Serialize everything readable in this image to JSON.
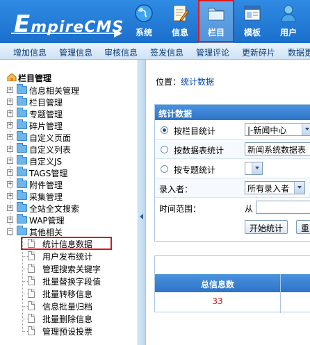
{
  "logo": {
    "first": "E",
    "rest": "mpireCMS"
  },
  "topnav": [
    {
      "label": "系统",
      "icon": "globe-icon"
    },
    {
      "label": "信息",
      "icon": "edit-note-icon"
    },
    {
      "label": "栏目",
      "icon": "folder-icon",
      "active": true
    },
    {
      "label": "模板",
      "icon": "template-window-icon"
    },
    {
      "label": "用户",
      "icon": "user-icon"
    }
  ],
  "submenu": [
    "增加信息",
    "管理信息",
    "审核信息",
    "签发信息",
    "管理评论",
    "更新碎片",
    "数据更"
  ],
  "tree": {
    "root": "栏目管理",
    "nodes": [
      "信息相关管理",
      "栏目管理",
      "专题管理",
      "碎片管理",
      "自定义页面",
      "自定义列表",
      "自定义JS",
      "TAGS管理",
      "附件管理",
      "采集管理",
      "全站全文搜索",
      "WAP管理",
      "其他相关"
    ],
    "children": [
      "统计信息数据",
      "用户发布统计",
      "管理搜索关键字",
      "批量替换字段值",
      "批量转移信息",
      "信息批量归档",
      "批量删除信息",
      "管理预设投票"
    ]
  },
  "breadcrumb": {
    "prefix": "位置：",
    "link": "统计数据"
  },
  "panel": {
    "title": "统计数据",
    "by_column": "按栏目统计",
    "by_column_value": "|-新闻中心",
    "by_table": "按数据表统计",
    "by_table_value": "新闻系统数据表",
    "by_topic": "按专题统计",
    "entry_user_label": "录入者：",
    "entry_user_value": "所有录入者",
    "time_range_label": "时间范围：",
    "from_label": "从",
    "start_button": "开始统计",
    "reset_button": "重"
  },
  "stats": {
    "total_header": "总信息数",
    "total_value": "33"
  },
  "colors": {
    "header_blue": "#2f8be3",
    "highlight_red": "#e01a1a",
    "count_red": "#d01010"
  }
}
